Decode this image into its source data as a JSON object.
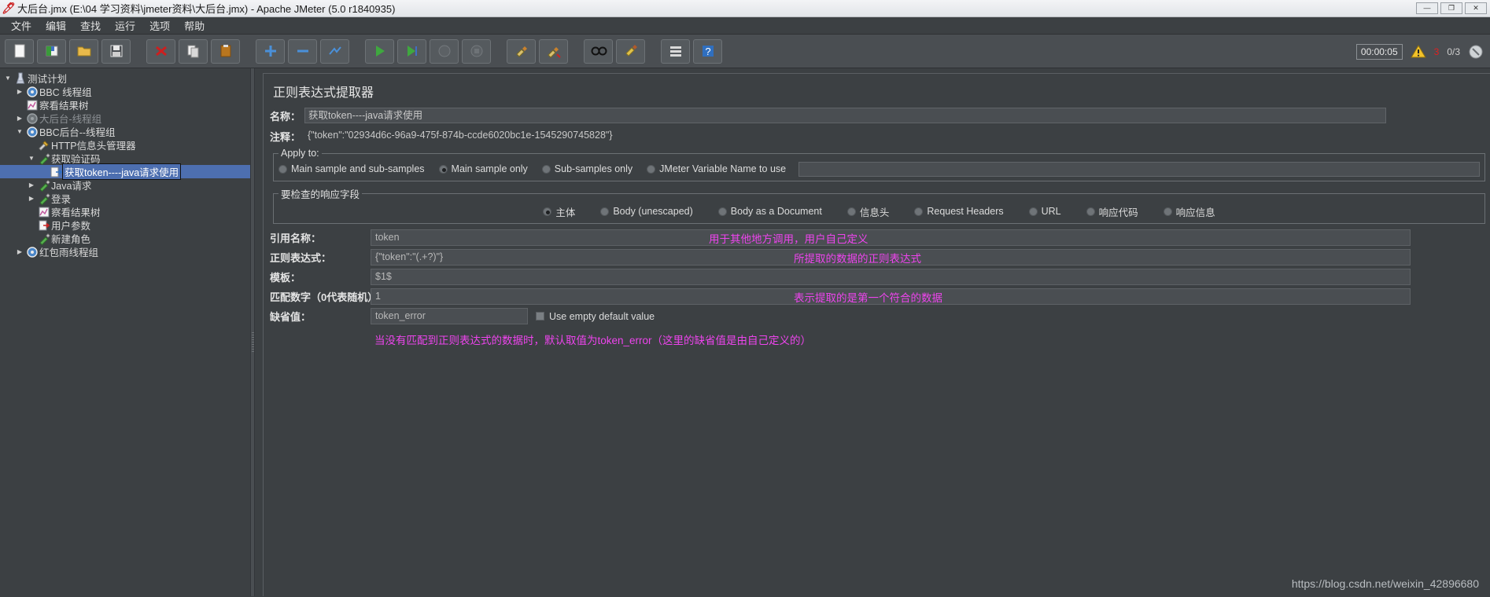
{
  "window": {
    "title": "大后台.jmx (E:\\04 学习资料\\jmeter资料\\大后台.jmx) - Apache JMeter (5.0 r1840935)",
    "icon": "jmeter-feather-icon",
    "buttons": {
      "minimize": "—",
      "maximize": "❐",
      "close": "✕"
    }
  },
  "menu": {
    "items": [
      {
        "label": "文件",
        "name": "menu-file"
      },
      {
        "label": "编辑",
        "name": "menu-edit"
      },
      {
        "label": "查找",
        "name": "menu-search"
      },
      {
        "label": "运行",
        "name": "menu-run"
      },
      {
        "label": "选项",
        "name": "menu-options"
      },
      {
        "label": "帮助",
        "name": "menu-help"
      }
    ]
  },
  "toolbar": {
    "buttons": [
      "new-icon",
      "templates-icon",
      "open-icon",
      "save-icon",
      "close-icon",
      "copy-icon",
      "paste-icon",
      "expand-icon",
      "collapse-icon",
      "toggle-icon",
      "start-icon",
      "start-no-pauses-icon",
      "stop-icon",
      "shutdown-icon",
      "clear-icon",
      "clear-all-icon",
      "search-icon",
      "search-reset-icon",
      "function-helper-icon",
      "help-icon"
    ],
    "status": {
      "timer": "00:00:05",
      "warning_icon": "warning-triangle-icon",
      "warning_count": "3",
      "threads": "0/3",
      "stop_icon": "stop-circle-icon"
    }
  },
  "tree": {
    "items": [
      {
        "label": "测试计划",
        "indent": 0,
        "twist": "▼",
        "icon": "test-plan-icon",
        "dim": false,
        "selected": false
      },
      {
        "label": "BBC 线程组",
        "indent": 1,
        "twist": "▶",
        "icon": "thread-group-icon",
        "dim": false,
        "selected": false
      },
      {
        "label": "察看结果树",
        "indent": 1,
        "twist": "",
        "icon": "view-results-icon",
        "dim": false,
        "selected": false
      },
      {
        "label": "大后台-线程组",
        "indent": 1,
        "twist": "▶",
        "icon": "thread-group-off-icon",
        "dim": true,
        "selected": false
      },
      {
        "label": "BBC后台--线程组",
        "indent": 1,
        "twist": "▼",
        "icon": "thread-group-icon",
        "dim": false,
        "selected": false
      },
      {
        "label": "HTTP信息头管理器",
        "indent": 2,
        "twist": "",
        "icon": "header-manager-icon",
        "dim": false,
        "selected": false
      },
      {
        "label": "获取验证码",
        "indent": 2,
        "twist": "▼",
        "icon": "sampler-icon",
        "dim": false,
        "selected": false
      },
      {
        "label": "获取token----java请求使用",
        "indent": 3,
        "twist": "",
        "icon": "regex-extractor-icon",
        "dim": false,
        "selected": true
      },
      {
        "label": "Java请求",
        "indent": 2,
        "twist": "▶",
        "icon": "sampler-icon",
        "dim": false,
        "selected": false
      },
      {
        "label": "登录",
        "indent": 2,
        "twist": "▶",
        "icon": "sampler-icon",
        "dim": false,
        "selected": false
      },
      {
        "label": "察看结果树",
        "indent": 2,
        "twist": "",
        "icon": "view-results-icon",
        "dim": false,
        "selected": false
      },
      {
        "label": "用户参数",
        "indent": 2,
        "twist": "",
        "icon": "user-parameters-icon",
        "dim": false,
        "selected": false
      },
      {
        "label": "新建角色",
        "indent": 2,
        "twist": "",
        "icon": "sampler-icon",
        "dim": false,
        "selected": false
      },
      {
        "label": "红包雨线程组",
        "indent": 1,
        "twist": "▶",
        "icon": "thread-group-icon",
        "dim": false,
        "selected": false
      }
    ]
  },
  "panel": {
    "title": "正则表达式提取器",
    "name": {
      "label": "名称：",
      "value": "获取token----java请求使用"
    },
    "comment": {
      "label": "注释：",
      "value": "{\"token\":\"02934d6c-96a9-475f-874b-ccde6020bc1e-1545290745828\"}"
    },
    "apply_to": {
      "legend": "Apply to:",
      "options": [
        {
          "label": "Main sample and sub-samples",
          "selected": false
        },
        {
          "label": "Main sample only",
          "selected": true
        },
        {
          "label": "Sub-samples only",
          "selected": false
        },
        {
          "label": "JMeter Variable Name to use",
          "selected": false
        }
      ],
      "variable_value": ""
    },
    "field_to_check": {
      "legend": "要检查的响应字段",
      "options": [
        {
          "label": "主体",
          "selected": true
        },
        {
          "label": "Body (unescaped)",
          "selected": false
        },
        {
          "label": "Body as a Document",
          "selected": false
        },
        {
          "label": "信息头",
          "selected": false
        },
        {
          "label": "Request Headers",
          "selected": false
        },
        {
          "label": "URL",
          "selected": false
        },
        {
          "label": "响应代码",
          "selected": false
        },
        {
          "label": "响应信息",
          "selected": false
        }
      ]
    },
    "fields": [
      {
        "label": "引用名称：",
        "value": "token",
        "annot": "用于其他地方调用，用户自己定义",
        "name": "reference-name"
      },
      {
        "label": "正则表达式：",
        "value": "{\"token\":\"(.+?)\"}",
        "annot": "所提取的数据的正则表达式",
        "name": "regular-expression"
      },
      {
        "label": "模板：",
        "value": "$1$",
        "annot": "",
        "name": "template"
      },
      {
        "label": "匹配数字（0代表随机）：",
        "value": "1",
        "annot": "表示提取的是第一个符合的数据",
        "name": "match-no"
      }
    ],
    "default_value": {
      "label": "缺省值：",
      "value": "token_error",
      "checkbox_label": "Use empty default value",
      "checked": false
    },
    "bottom_annotation": "当没有匹配到正则表达式的数据时，默认取值为token_error（这里的缺省值是由自己定义的）"
  },
  "watermark": "https://blog.csdn.net/weixin_42896680",
  "colors": {
    "accent_selection": "#4d6fb0",
    "annotation_pink": "#ee44ee",
    "warning_red": "#e02020",
    "panel_bg": "#3c4043"
  }
}
